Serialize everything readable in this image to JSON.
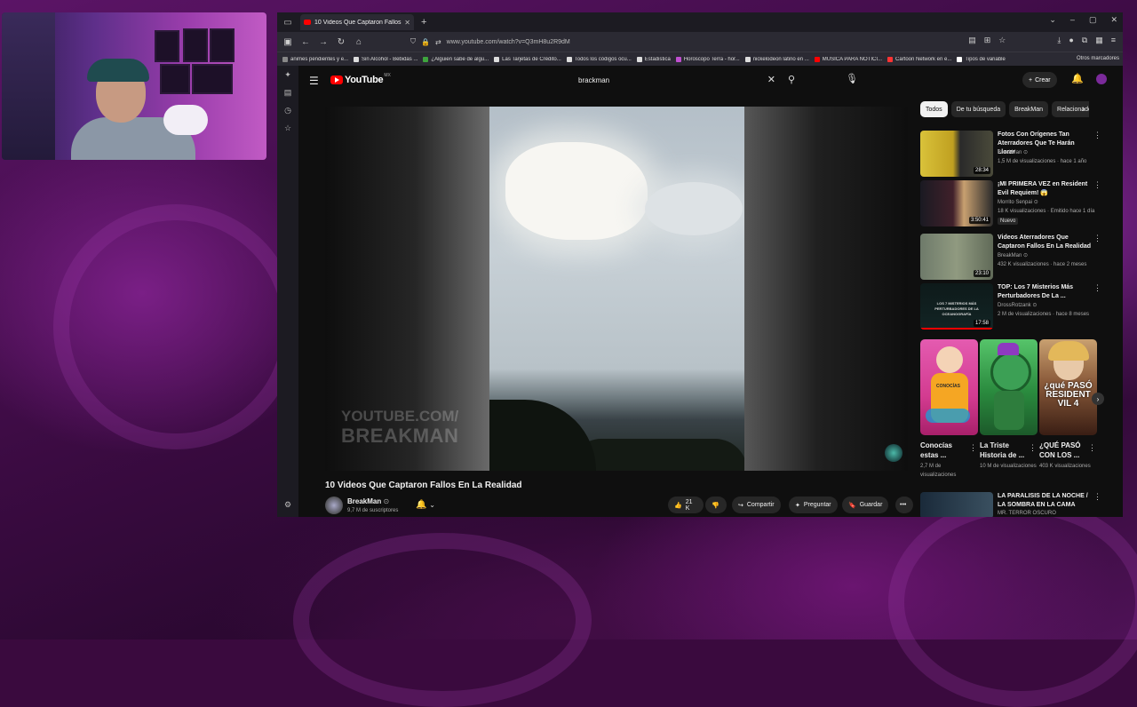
{
  "browser": {
    "tab_title": "10 Videos Que Captaron Fallos",
    "url": "www.youtube.com/watch?v=Q3mH8u2R9dM",
    "bookmarks": [
      {
        "label": "animes pendientes y e...",
        "color": "#888888"
      },
      {
        "label": "Sin Alcohol - Bebidas ...",
        "color": "#dddddd"
      },
      {
        "label": "¿Alguien sabe de algu...",
        "color": "#3ea43e"
      },
      {
        "label": "Las Tarjetas de Crédito...",
        "color": "#dddddd"
      },
      {
        "label": "Todos los códigos ocu...",
        "color": "#dddddd"
      },
      {
        "label": "Estadistica",
        "color": "#dddddd"
      },
      {
        "label": "Horoscopo Terra - hor...",
        "color": "#c04fd0"
      },
      {
        "label": "nickelodeon latino en ...",
        "color": "#dddddd"
      },
      {
        "label": "MUSICA PARA NOTICI...",
        "color": "#ff0000"
      },
      {
        "label": "Cartoon Network en e...",
        "color": "#ff3333"
      },
      {
        "label": "Tipos de variable",
        "color": "#ffffff"
      }
    ],
    "other_bookmarks": "Otros marcadores"
  },
  "youtube": {
    "logo": "YouTube",
    "country": "MX",
    "search_value": "brackman",
    "create_label": "Crear"
  },
  "video": {
    "title": "10 Videos Que Captaron Fallos En La Realidad",
    "watermark_line1": "YOUTUBE.COM/",
    "watermark_line2": "BREAKMAN",
    "channel": "BreakMan",
    "subscribers": "9,7 M de suscriptores",
    "likes": "21 K",
    "share_label": "Compartir",
    "ask_label": "Preguntar",
    "save_label": "Guardar"
  },
  "chips": [
    "Todos",
    "De tu búsqueda",
    "BreakMan",
    "Relacionado"
  ],
  "recommendations": [
    {
      "title": "Fotos Con Orígenes Tan Aterradores Que Te Harán Llorar",
      "channel": "BreakMan",
      "views": "1,5 M de visualizaciones · hace 1 año",
      "duration": "28:34",
      "badge": ""
    },
    {
      "title": "¡MI PRIMERA VEZ en Resident Evil Requiem! 😱",
      "channel": "Morrito Senpai",
      "views": "18 K visualizaciones · Emitido hace 1 día",
      "duration": "3:50:41",
      "badge": "Nuevo"
    },
    {
      "title": "Videos Aterradores Que Captaron Fallos En La Realidad",
      "channel": "BreakMan",
      "views": "432 K visualizaciones · hace 2 meses",
      "duration": "23:10",
      "badge": ""
    },
    {
      "title": "TOP: Los 7 Misterios Más Perturbadores De La ...",
      "channel": "DrossRotzank",
      "views": "2 M de visualizaciones · hace 8 meses",
      "duration": "17:58",
      "badge": "",
      "thumb_text": "LOS 7 MISTERIOS MÁS PERTURBADORES DE LA OCEANOGRAFÍA"
    }
  ],
  "shorts": [
    {
      "title": "Conocías estas ...",
      "views": "2,7 M de visualizaciones",
      "thumb_text": "CONOCÍAS"
    },
    {
      "title": "La Triste Historia de ...",
      "views": "10 M de visualizaciones",
      "thumb_text": ""
    },
    {
      "title": "¿QUÉ PASÓ CON LOS ...",
      "views": "403 K visualizaciones",
      "thumb_text": "¿qué PASÓ RESIDENT VIL 4"
    }
  ],
  "last_rec": {
    "title": "LA PARALISIS DE LA NOCHE / LA SOMBRA EN LA CAMA",
    "channel": "MR. TERROR OSCURO"
  },
  "colors": {
    "accent_red": "#ff0000",
    "bg": "#0f0f0f",
    "chip": "#272727"
  }
}
